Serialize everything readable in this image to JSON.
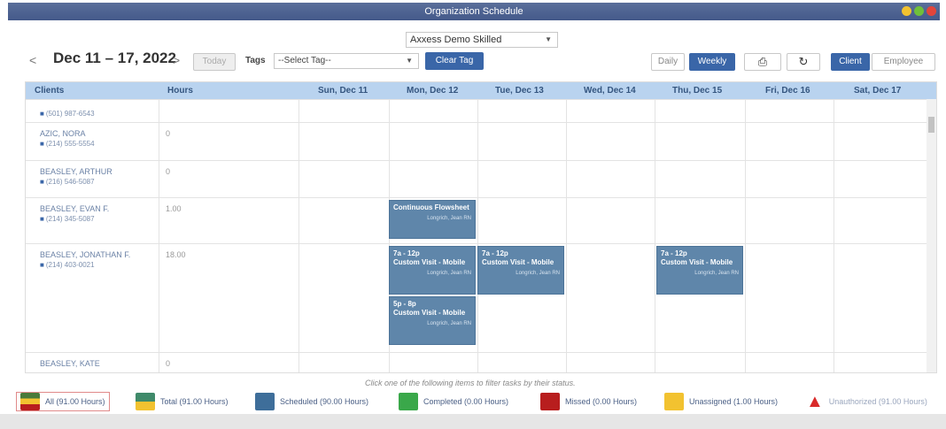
{
  "window": {
    "title": "Organization Schedule",
    "btn_colors": [
      "#f2c230",
      "#6fbf3a",
      "#e2453b"
    ]
  },
  "toolbar": {
    "service": "Axxess Demo Skilled",
    "date_range": "Dec 11 – 17, 2022",
    "prev": "<",
    "next": ">",
    "today": "Today",
    "tags_label": "Tags",
    "tag_placeholder": "--Select Tag--",
    "clear_tag": "Clear Tag",
    "daily": "Daily",
    "weekly": "Weekly",
    "client": "Client",
    "employee": "Employee"
  },
  "grid": {
    "headers": [
      "Clients",
      "Hours",
      "Sun, Dec 11",
      "Mon, Dec 12",
      "Tue, Dec 13",
      "Wed, Dec 14",
      "Thu, Dec 15",
      "Fri, Dec 16",
      "Sat, Dec 17"
    ],
    "rows": [
      {
        "name": "",
        "phone": "(501) 987-6543",
        "hours": ""
      },
      {
        "name": "AZIC, NORA",
        "phone": "(214) 555-5554",
        "hours": "0"
      },
      {
        "name": "BEASLEY, ARTHUR",
        "phone": "(216) 546-5087",
        "hours": "0"
      },
      {
        "name": "BEASLEY, EVAN F.",
        "phone": "(214) 345-5087",
        "hours": "1.00"
      },
      {
        "name": "BEASLEY, JONATHAN F.",
        "phone": "(214) 403-0021",
        "hours": "18.00"
      },
      {
        "name": "BEASLEY, KATE",
        "phone": "",
        "hours": "0"
      }
    ],
    "events": [
      {
        "title": "Continuous Flowsheet",
        "time": "",
        "sub": "Longrich, Jean RN"
      },
      {
        "time": "7a - 12p",
        "title": "Custom Visit - Mobile",
        "sub": "Longrich, Jean RN"
      },
      {
        "time": "7a - 12p",
        "title": "Custom Visit - Mobile",
        "sub": "Longrich, Jean RN"
      },
      {
        "time": "7a - 12p",
        "title": "Custom Visit - Mobile",
        "sub": "Longrich, Jean RN"
      },
      {
        "time": "5p - 8p",
        "title": "Custom Visit - Mobile",
        "sub": "Longrich, Jean RN"
      }
    ]
  },
  "footnote": "Click one of the following items to filter tasks by their status.",
  "legend": [
    {
      "label": "All (91.00 Hours)",
      "color": "#4a7a3a"
    },
    {
      "label": "Total (91.00 Hours)",
      "color": "#3f8a6a"
    },
    {
      "label": "Scheduled (90.00 Hours)",
      "color": "#3e6e9a"
    },
    {
      "label": "Completed (0.00 Hours)",
      "color": "#3aa84a"
    },
    {
      "label": "Missed (0.00 Hours)",
      "color": "#b81e1e"
    },
    {
      "label": "Unassigned (1.00 Hours)",
      "color": "#f2c230"
    },
    {
      "label": "Unauthorized (91.00 Hours)",
      "color": "#d92a2a"
    }
  ]
}
